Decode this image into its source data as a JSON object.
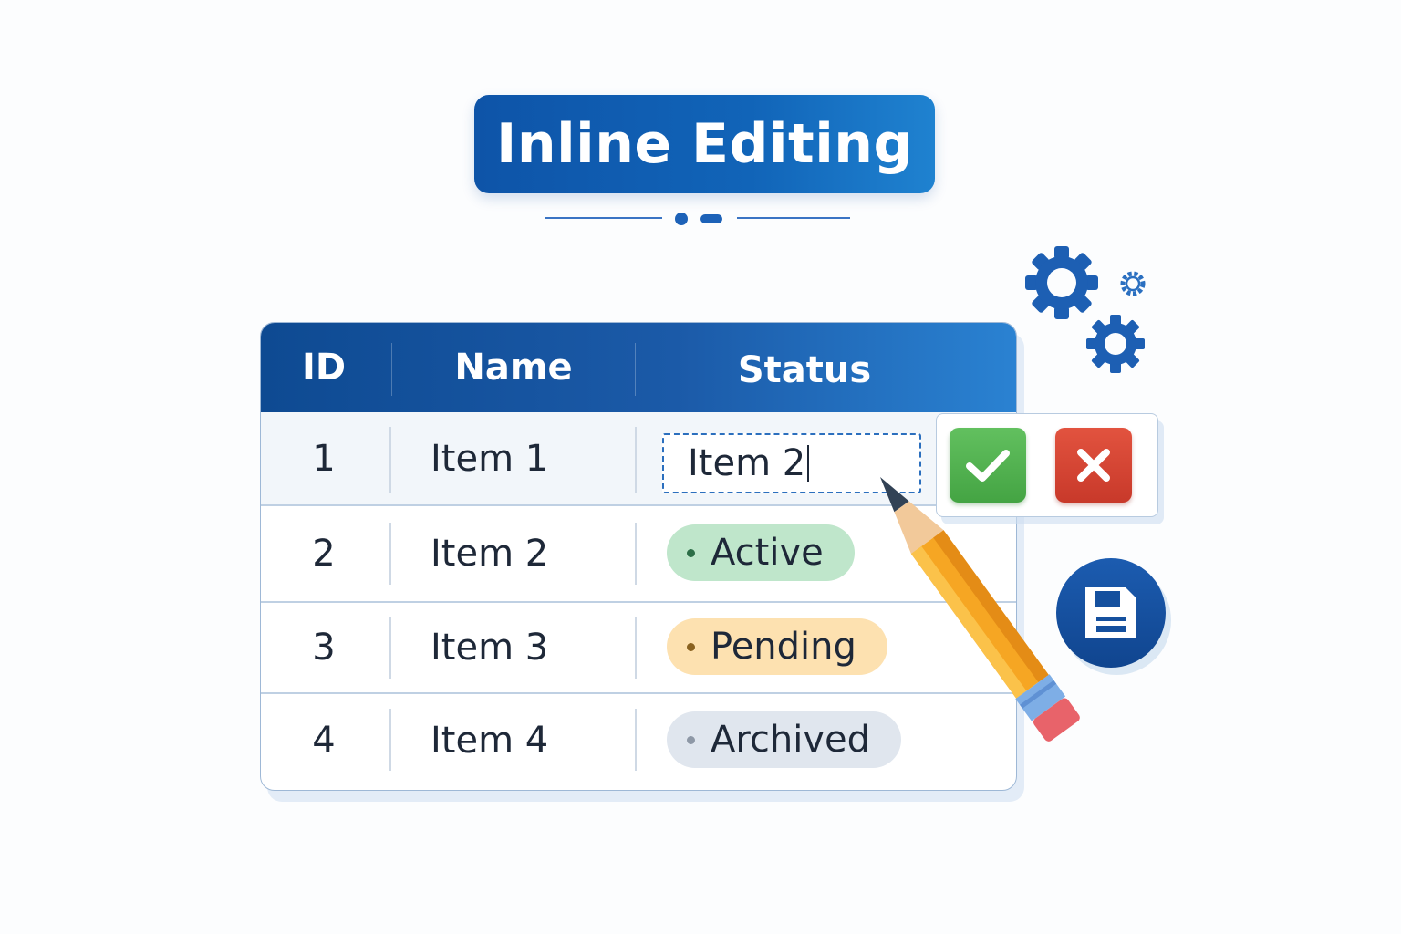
{
  "title": "Inline Editing",
  "table": {
    "columns": [
      "ID",
      "Name",
      "Status"
    ],
    "rows": [
      {
        "id": "1",
        "name": "Item 1",
        "status": null
      },
      {
        "id": "2",
        "name": "Item 2",
        "status": "Active"
      },
      {
        "id": "3",
        "name": "Item 3",
        "status": "Pending"
      },
      {
        "id": "4",
        "name": "Item 4",
        "status": "Archived"
      }
    ],
    "editing": {
      "row": 1,
      "column": "Status",
      "value": "Item 2"
    }
  },
  "status_colors": {
    "Active": {
      "bg": "#bfe6cb",
      "dot": "#2c6e47"
    },
    "Pending": {
      "bg": "#fde1b0",
      "dot": "#8a6220"
    },
    "Archived": {
      "bg": "#e0e6ee",
      "dot": "#8e98a6"
    }
  },
  "icons": {
    "confirm": "check-icon",
    "cancel": "close-icon",
    "save": "floppy-disk-icon",
    "settings": "gears-icon",
    "edit": "pencil-icon"
  },
  "colors": {
    "primary": "#1158b0",
    "confirm": "#4caf50",
    "cancel": "#d84332"
  }
}
